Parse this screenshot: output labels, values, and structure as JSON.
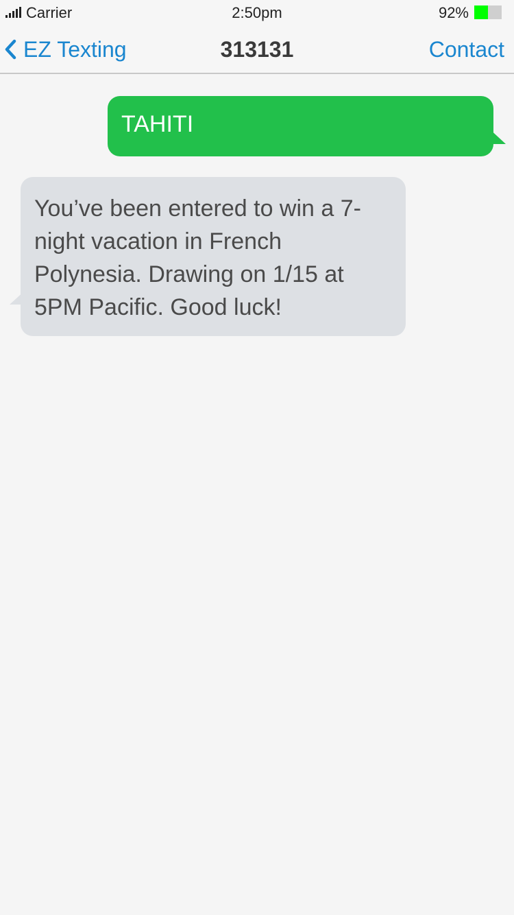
{
  "status_bar": {
    "carrier": "Carrier",
    "time": "2:50pm",
    "battery_percent": "92%",
    "battery_level": 0.5,
    "battery_color": "#00ff00",
    "signal_icon": "signal-bars-icon"
  },
  "nav": {
    "back_label": "EZ Texting",
    "back_icon": "chevron-left-icon",
    "title": "313131",
    "contact_label": "Contact",
    "accent": "#1a86cf"
  },
  "messages": [
    {
      "direction": "outgoing",
      "text": "TAHITI",
      "color": "#22c04b"
    },
    {
      "direction": "incoming",
      "text": "You’ve been entered to win a 7-night vacation in French Polynesia. Drawing on 1/15 at 5PM Pacific. Good luck!",
      "color": "#dde0e4"
    }
  ]
}
